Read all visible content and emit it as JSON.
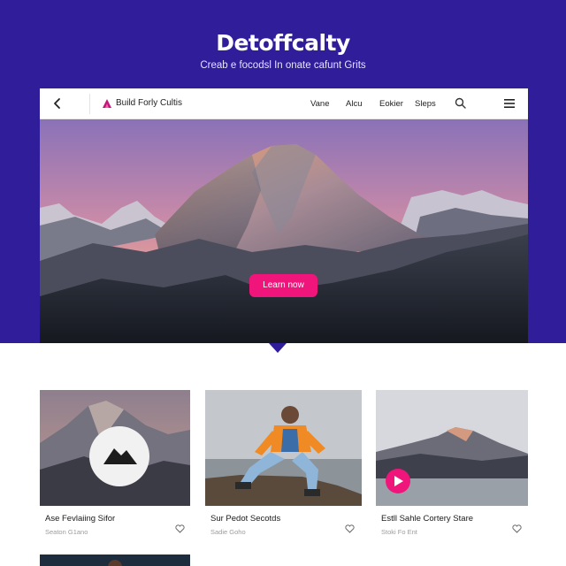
{
  "hero": {
    "headline": "Detoffcalty",
    "tagline": "Creab e focodsl In onate cafunt Grits",
    "cta_label": "Learn now"
  },
  "navbar": {
    "brand": "Build Forly Cultis",
    "links": [
      "Vane",
      "Alcu",
      "Eokier",
      "Sleps"
    ],
    "icons": [
      "back-arrow-icon",
      "brand-logo-icon",
      "search-icon",
      "hamburger-menu-icon"
    ]
  },
  "cards": [
    {
      "title": "Ase Fevlaiing Sifor",
      "meta": "Seaton G1ano",
      "thumb": "mountain-with-badge"
    },
    {
      "title": "Sur Pedot Secotds",
      "meta": "Sadie Goho",
      "thumb": "person-on-rock"
    },
    {
      "title": "Estll Sahle Cortery Stare",
      "meta": "Stoki Fo Ent",
      "thumb": "lake-mountain"
    }
  ],
  "colors": {
    "hero_background": "#2f1d9a",
    "accent": "#f0157a",
    "text": "#1a1a1a",
    "muted": "#9c9c9c"
  }
}
